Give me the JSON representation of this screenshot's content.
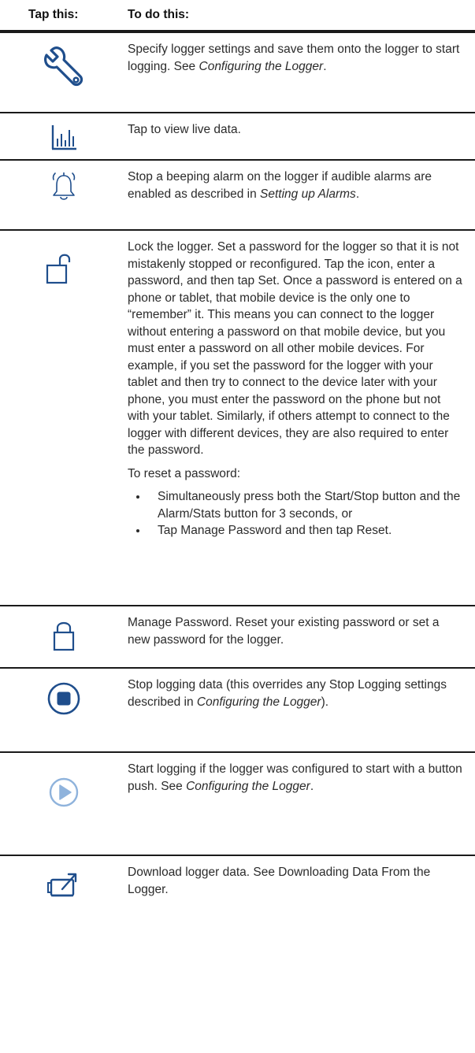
{
  "header": {
    "col1": "Tap this:",
    "col2": "To do this:"
  },
  "rows": [
    {
      "icon": "wrench-icon",
      "text_before": "Specify logger settings and save them onto the logger to start logging. See ",
      "text_italic": "Configuring the Logger",
      "text_after": "."
    },
    {
      "icon": "bar-chart-icon",
      "text": "Tap to view live data."
    },
    {
      "icon": "bell-alarm-icon",
      "text_before": "Stop a beeping alarm on the logger if audible alarms are enabled as described in ",
      "text_italic": "Setting up Alarms",
      "text_after": "."
    },
    {
      "icon": "unlocked-padlock-icon",
      "text": "Lock the logger. Set a password for the logger so that it is not mistakenly stopped or reconfigured. Tap the icon, enter a password, and then tap Set. Once a password is entered on a phone or tablet, that mobile device is the only one to “remember” it. This means you can connect to the logger without entering a password on that mobile device, but you must enter a password on all other mobile devices. For example, if you set the password for the logger with your tablet and then try to connect to the device later with your phone, you must enter the password on the phone but not with your tablet. Similarly, if others attempt to connect to the logger with different devices, they are also required to enter the password.",
      "subtext": "To reset a password:",
      "bullets": [
        "Simultaneously press both the Start/Stop button and the Alarm/Stats button for 3 seconds, or",
        "Tap Manage Password and then tap Reset."
      ]
    },
    {
      "icon": "locked-padlock-icon",
      "text": "Manage Password. Reset your existing password or set a new password for the logger."
    },
    {
      "icon": "stop-circle-icon",
      "text_before": "Stop logging data (this overrides any Stop Logging settings described in ",
      "text_italic": "Configuring the Logger",
      "text_after": ")."
    },
    {
      "icon": "play-circle-icon",
      "text_before": "Start logging if the logger was configured to start with a button push. See ",
      "text_italic": "Configuring the Logger",
      "text_after": "."
    },
    {
      "icon": "download-icon",
      "text": "Download logger data. See Downloading Data From the Logger."
    }
  ],
  "colors": {
    "icon_blue": "#1f4e8c",
    "icon_light_blue": "#8fb3dc",
    "rule": "#1a1a1a"
  }
}
